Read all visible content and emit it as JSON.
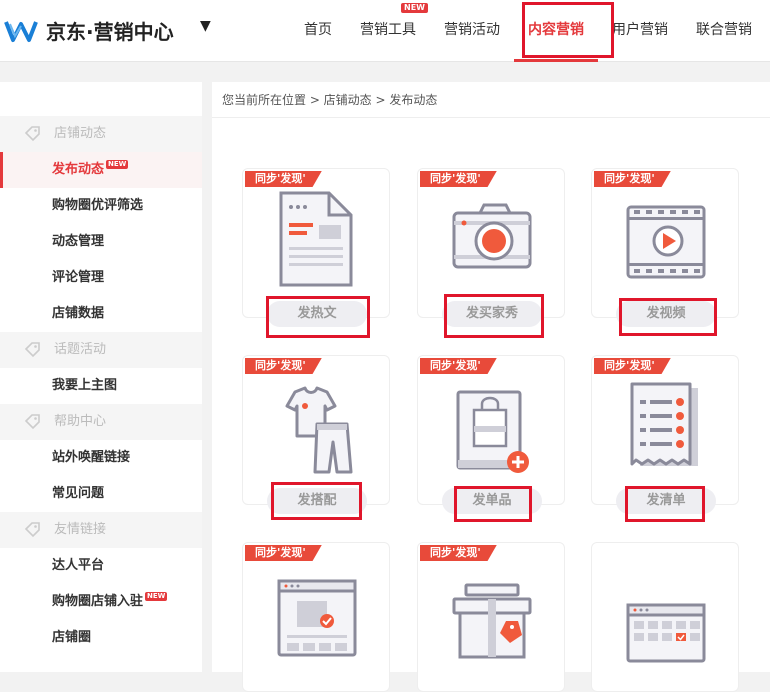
{
  "header": {
    "brand": "京东·营销中心",
    "brand_arrow": "▼",
    "nav": [
      {
        "label": "首页",
        "new": ""
      },
      {
        "label": "营销工具",
        "new": "NEW"
      },
      {
        "label": "营销活动",
        "new": ""
      },
      {
        "label": "内容营销",
        "new": ""
      },
      {
        "label": "用户营销",
        "new": ""
      },
      {
        "label": "联合营销",
        "new": ""
      }
    ],
    "active_nav": "内容营销"
  },
  "sidebar": {
    "groups": [
      {
        "title": "店铺动态",
        "items": [
          {
            "label": "发布动态",
            "new": "NEW",
            "active": true
          },
          {
            "label": "购物圈优评筛选"
          },
          {
            "label": "动态管理"
          },
          {
            "label": "评论管理"
          },
          {
            "label": "店铺数据"
          }
        ]
      },
      {
        "title": "话题活动",
        "items": [
          {
            "label": "我要上主图"
          }
        ]
      },
      {
        "title": "帮助中心",
        "items": [
          {
            "label": "站外唤醒链接"
          },
          {
            "label": "常见问题"
          }
        ]
      },
      {
        "title": "友情链接",
        "items": [
          {
            "label": "达人平台"
          },
          {
            "label": "购物圈店铺入驻",
            "new": "NEW"
          },
          {
            "label": "店铺圈"
          }
        ]
      }
    ]
  },
  "breadcrumb": "您当前所在位置 > 店铺动态 > 发布动态",
  "cards": [
    {
      "tag": "同步'发现'",
      "label": "发热文",
      "icon": "document-icon"
    },
    {
      "tag": "同步'发现'",
      "label": "发买家秀",
      "icon": "camera-icon"
    },
    {
      "tag": "同步'发现'",
      "label": "发视频",
      "icon": "video-icon"
    },
    {
      "tag": "同步'发现'",
      "label": "发搭配",
      "icon": "outfit-icon"
    },
    {
      "tag": "同步'发现'",
      "label": "发单品",
      "icon": "shopping-bag-icon"
    },
    {
      "tag": "同步'发现'",
      "label": "发清单",
      "icon": "checklist-icon"
    },
    {
      "tag": "同步'发现'",
      "label": "",
      "icon": "browser-window-icon"
    },
    {
      "tag": "同步'发现'",
      "label": "",
      "icon": "gift-box-icon"
    },
    {
      "tag": "",
      "label": "",
      "icon": "calendar-icon"
    }
  ],
  "colors": {
    "accent": "#e4393c",
    "tag_bg": "#e84a3a",
    "highlight_box": "#e0162b",
    "icon_stroke": "#8a8a9a",
    "icon_orange": "#f05a3c"
  }
}
